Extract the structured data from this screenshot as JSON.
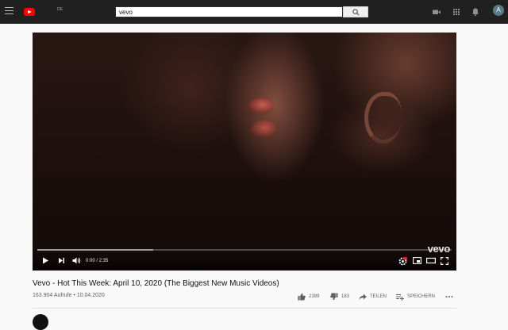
{
  "header": {
    "region_label": "DE",
    "search": {
      "value": "vevo"
    },
    "avatar_initial": "A",
    "icons": [
      "menu-icon",
      "youtube-logo",
      "search-icon",
      "create-video-icon",
      "apps-grid-icon",
      "notifications-bell-icon"
    ]
  },
  "player": {
    "watermark": "vevo",
    "progress_fraction": 0.0,
    "buffered_fraction": 0.28,
    "time_display": "0:00 / 2:35",
    "controls": [
      "play-icon",
      "next-icon",
      "volume-icon",
      "settings-icon",
      "miniplayer-icon",
      "theater-mode-icon",
      "fullscreen-icon"
    ]
  },
  "video": {
    "title": "Vevo - Hot This Week: April 10, 2020 (The Biggest New Music Videos)",
    "views_date": "163.904 Aufrufe • 10.04.2020",
    "likes": "2399",
    "dislikes": "183",
    "share_label": "TEILEN",
    "save_label": "SPEICHERN"
  },
  "colors": {
    "topbar": "#202020",
    "brand_red": "#ff0000",
    "page_bg": "#f9f9f9"
  }
}
